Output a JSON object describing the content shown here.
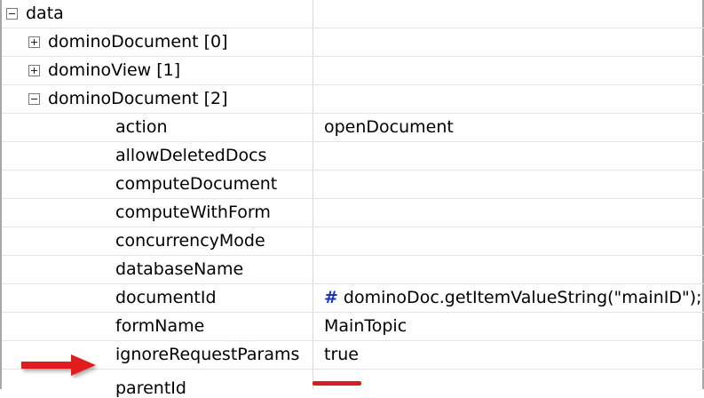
{
  "tree": {
    "root": {
      "label": "data"
    },
    "children": [
      {
        "label": "dominoDocument [0]"
      },
      {
        "label": "dominoView [1]"
      },
      {
        "label": "dominoDocument [2]"
      }
    ]
  },
  "properties": [
    {
      "name": "action",
      "value": "openDocument"
    },
    {
      "name": "allowDeletedDocs",
      "value": ""
    },
    {
      "name": "computeDocument",
      "value": ""
    },
    {
      "name": "computeWithForm",
      "value": ""
    },
    {
      "name": "concurrencyMode",
      "value": ""
    },
    {
      "name": "databaseName",
      "value": ""
    },
    {
      "name": "documentId",
      "computed_marker": "#",
      "value": "dominoDoc.getItemValueString(\"mainID\");"
    },
    {
      "name": "formName",
      "value": "MainTopic"
    },
    {
      "name": "ignoreRequestParams",
      "value": "true"
    }
  ],
  "partial_row": {
    "name": "parentId"
  },
  "annotation": {
    "arrow_color": "#e01b1b",
    "underline_color": "#e01b1b"
  }
}
